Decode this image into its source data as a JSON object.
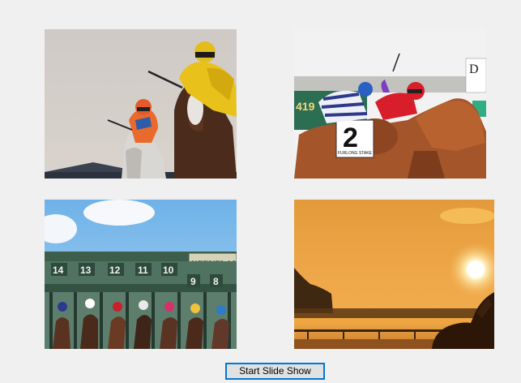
{
  "slideshow": {
    "start_button_label": "Start Slide Show"
  },
  "photos": [
    {
      "subject": "two jockeys in orange and yellow silks racing toward camera"
    },
    {
      "subject": "racehorses and jockeys in striped and red silks with number 2 saddlecloth"
    },
    {
      "subject": "horses breaking from the starting gate under a Keeneland sign"
    },
    {
      "subject": "sunset over the racetrack with a horse silhouette"
    }
  ],
  "photo_text": {
    "saddlecloth_number": "2",
    "saddlecloth_caption": "FURLONG STAKE",
    "tote_board_digits": "419",
    "sign_letter": "D",
    "gate_numbers": [
      "14",
      "13",
      "12",
      "11",
      "10",
      "9",
      "8"
    ],
    "gate_sign": "KEENELAN"
  },
  "colors": {
    "window_background": "#f0f0f0",
    "button_face": "#e1e1e1",
    "button_focus_border": "#0078d7"
  }
}
